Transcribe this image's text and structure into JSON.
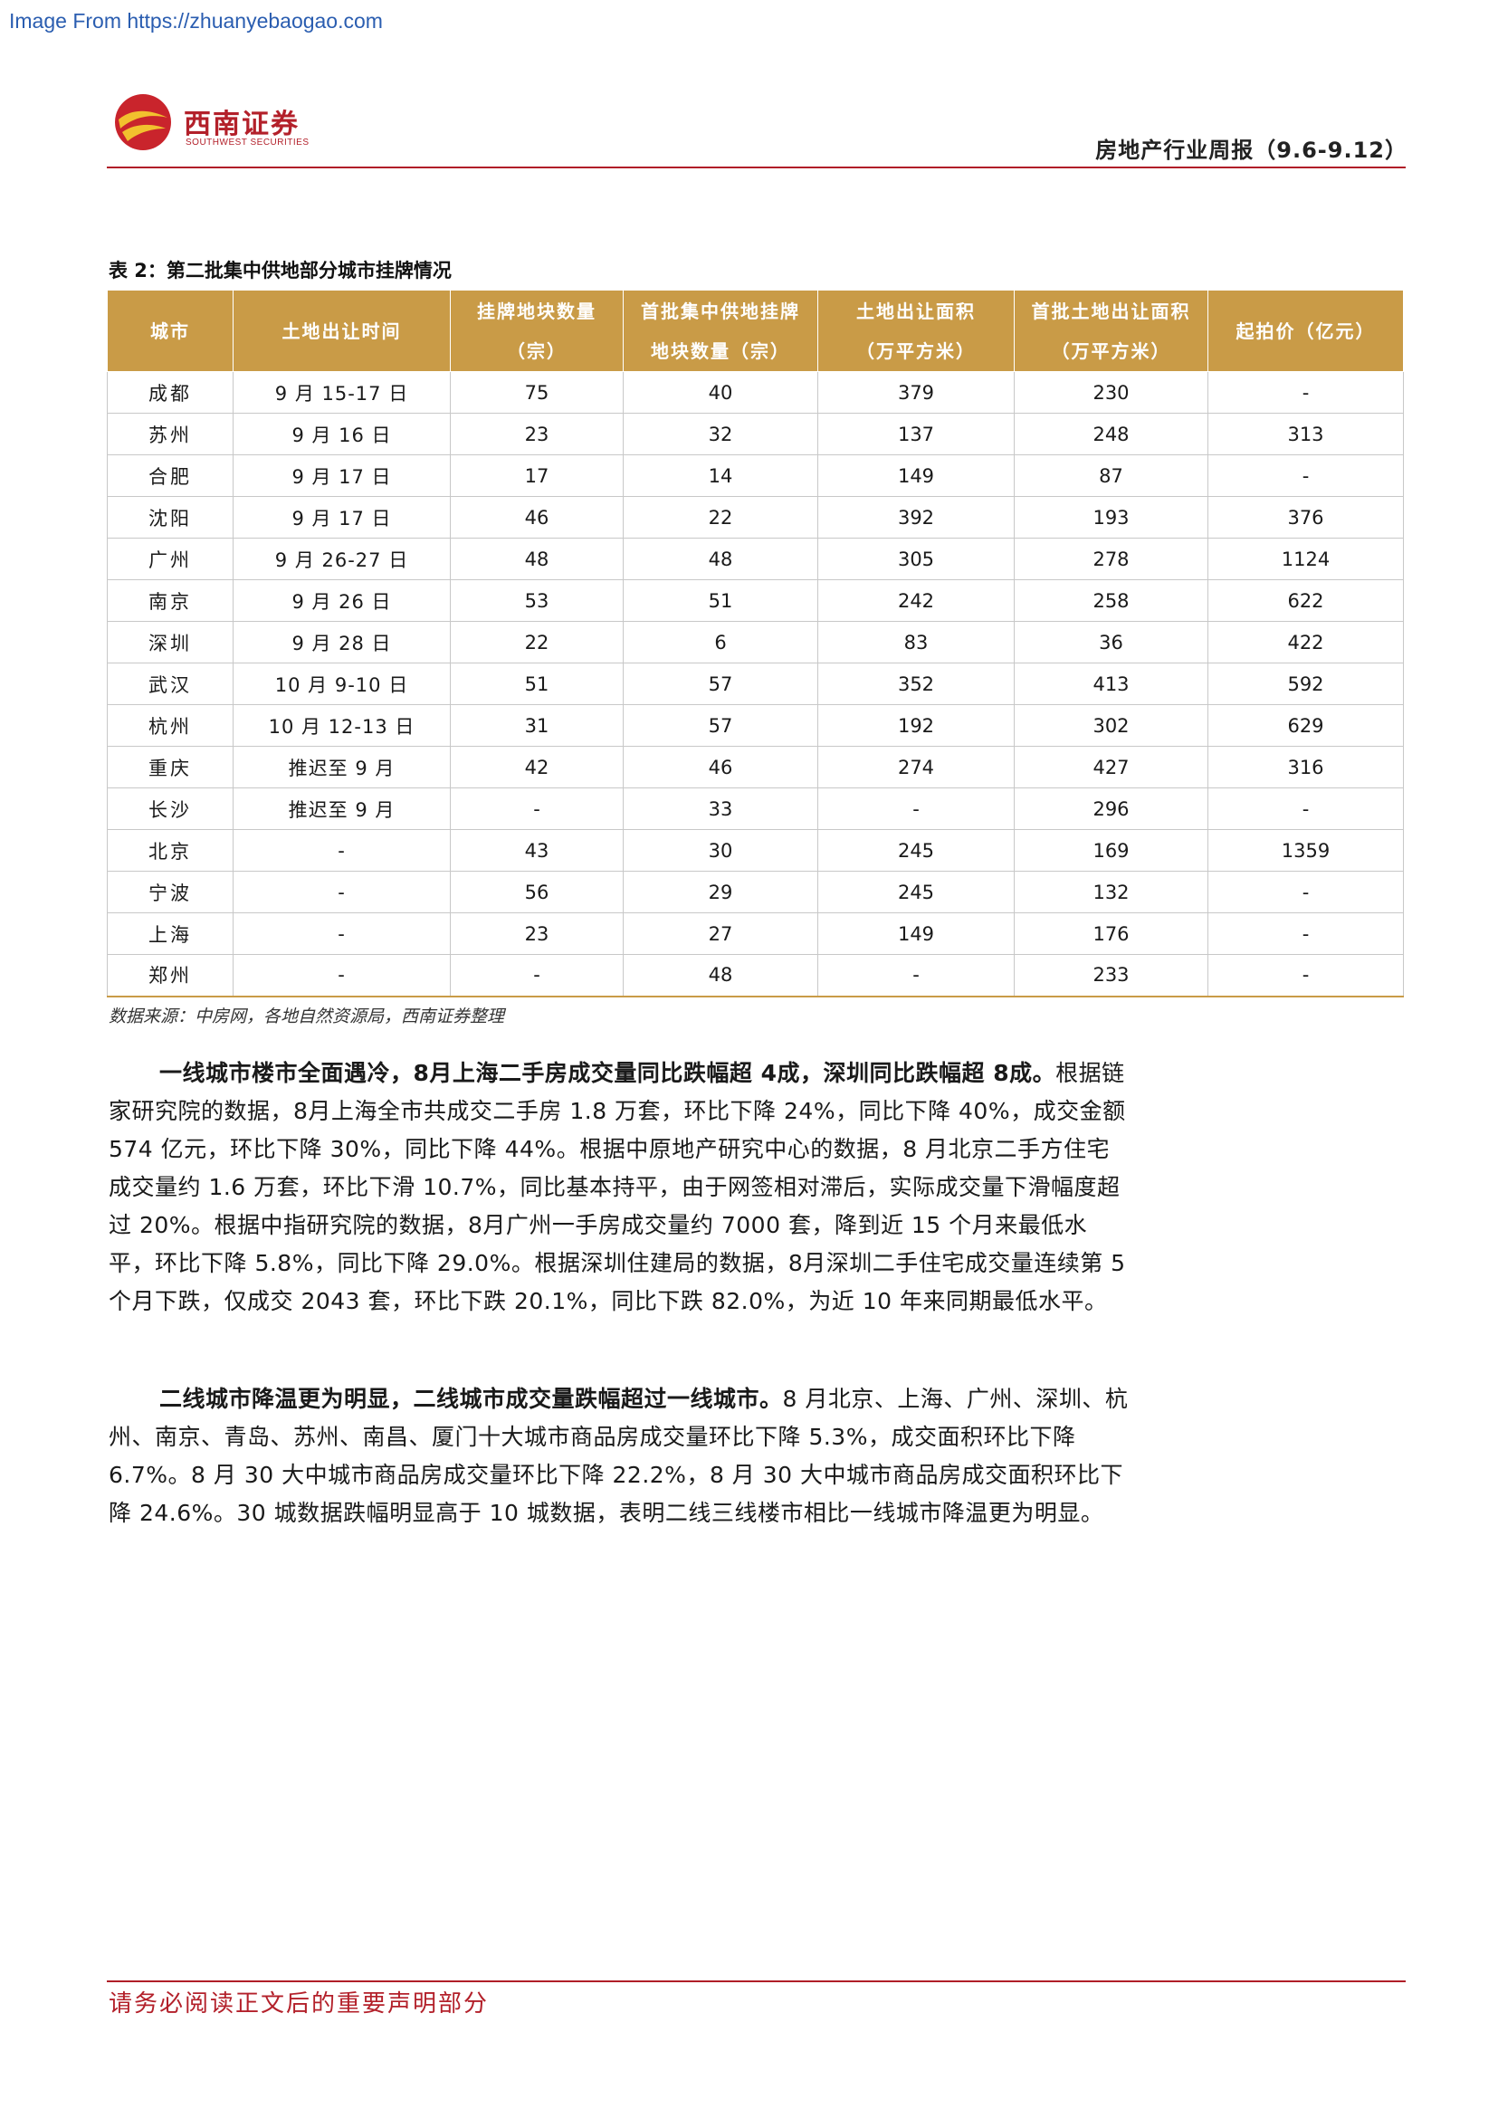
{
  "watermark": "Image From https://zhuanyebaogao.com",
  "logo": {
    "cn": "西南证券",
    "en": "SOUTHWEST SECURITIES"
  },
  "header": {
    "report_title": "房地产行业周报（9.6-9.12）"
  },
  "colors": {
    "accent": "#b01e28",
    "table_header": "#c99b47"
  },
  "table": {
    "caption": "表 2：第二批集中供地部分城市挂牌情况",
    "headers": [
      {
        "line1": "城市",
        "line2": ""
      },
      {
        "line1": "土地出让时间",
        "line2": ""
      },
      {
        "line1": "挂牌地块数量",
        "line2": "（宗）"
      },
      {
        "line1": "首批集中供地挂牌",
        "line2": "地块数量（宗）"
      },
      {
        "line1": "土地出让面积",
        "line2": "（万平方米）"
      },
      {
        "line1": "首批土地出让面积",
        "line2": "（万平方米）"
      },
      {
        "line1": "起拍价（亿元）",
        "line2": ""
      }
    ],
    "rows": [
      [
        "成都",
        "9 月 15-17 日",
        "75",
        "40",
        "379",
        "230",
        "-"
      ],
      [
        "苏州",
        "9 月 16 日",
        "23",
        "32",
        "137",
        "248",
        "313"
      ],
      [
        "合肥",
        "9 月 17 日",
        "17",
        "14",
        "149",
        "87",
        "-"
      ],
      [
        "沈阳",
        "9 月 17 日",
        "46",
        "22",
        "392",
        "193",
        "376"
      ],
      [
        "广州",
        "9 月 26-27 日",
        "48",
        "48",
        "305",
        "278",
        "1124"
      ],
      [
        "南京",
        "9 月 26 日",
        "53",
        "51",
        "242",
        "258",
        "622"
      ],
      [
        "深圳",
        "9 月 28 日",
        "22",
        "6",
        "83",
        "36",
        "422"
      ],
      [
        "武汉",
        "10 月 9-10 日",
        "51",
        "57",
        "352",
        "413",
        "592"
      ],
      [
        "杭州",
        "10 月 12-13 日",
        "31",
        "57",
        "192",
        "302",
        "629"
      ],
      [
        "重庆",
        "推迟至 9 月",
        "42",
        "46",
        "274",
        "427",
        "316"
      ],
      [
        "长沙",
        "推迟至 9 月",
        "-",
        "33",
        "-",
        "296",
        "-"
      ],
      [
        "北京",
        "-",
        "43",
        "30",
        "245",
        "169",
        "1359"
      ],
      [
        "宁波",
        "-",
        "56",
        "29",
        "245",
        "132",
        "-"
      ],
      [
        "上海",
        "-",
        "23",
        "27",
        "149",
        "176",
        "-"
      ],
      [
        "郑州",
        "-",
        "-",
        "48",
        "-",
        "233",
        "-"
      ]
    ],
    "source": "数据来源：中房网，各地自然资源局，西南证券整理"
  },
  "paragraphs": [
    {
      "lead": "一线城市楼市全面遇冷，8月上海二手房成交量同比跌幅超 4成，深圳同比跌幅超 8成。",
      "body": "根据链家研究院的数据，8月上海全市共成交二手房 1.8 万套，环比下降 24%，同比下降 40%，成交金额 574 亿元，环比下降 30%，同比下降 44%。根据中原地产研究中心的数据，8 月北京二手方住宅成交量约 1.6 万套，环比下滑 10.7%，同比基本持平，由于网签相对滞后，实际成交量下滑幅度超过 20%。根据中指研究院的数据，8月广州一手房成交量约 7000 套，降到近 15 个月来最低水平，环比下降 5.8%，同比下降 29.0%。根据深圳住建局的数据，8月深圳二手住宅成交量连续第 5 个月下跌，仅成交 2043 套，环比下跌 20.1%，同比下跌 82.0%，为近 10 年来同期最低水平。"
    },
    {
      "lead": "二线城市降温更为明显，二线城市成交量跌幅超过一线城市。",
      "body": "8 月北京、上海、广州、深圳、杭州、南京、青岛、苏州、南昌、厦门十大城市商品房成交量环比下降 5.3%，成交面积环比下降 6.7%。8 月 30 大中城市商品房成交量环比下降 22.2%，8 月 30 大中城市商品房成交面积环比下降 24.6%。30 城数据跌幅明显高于 10 城数据，表明二线三线楼市相比一线城市降温更为明显。"
    }
  ],
  "footer": {
    "disclaimer": "请务必阅读正文后的重要声明部分"
  }
}
